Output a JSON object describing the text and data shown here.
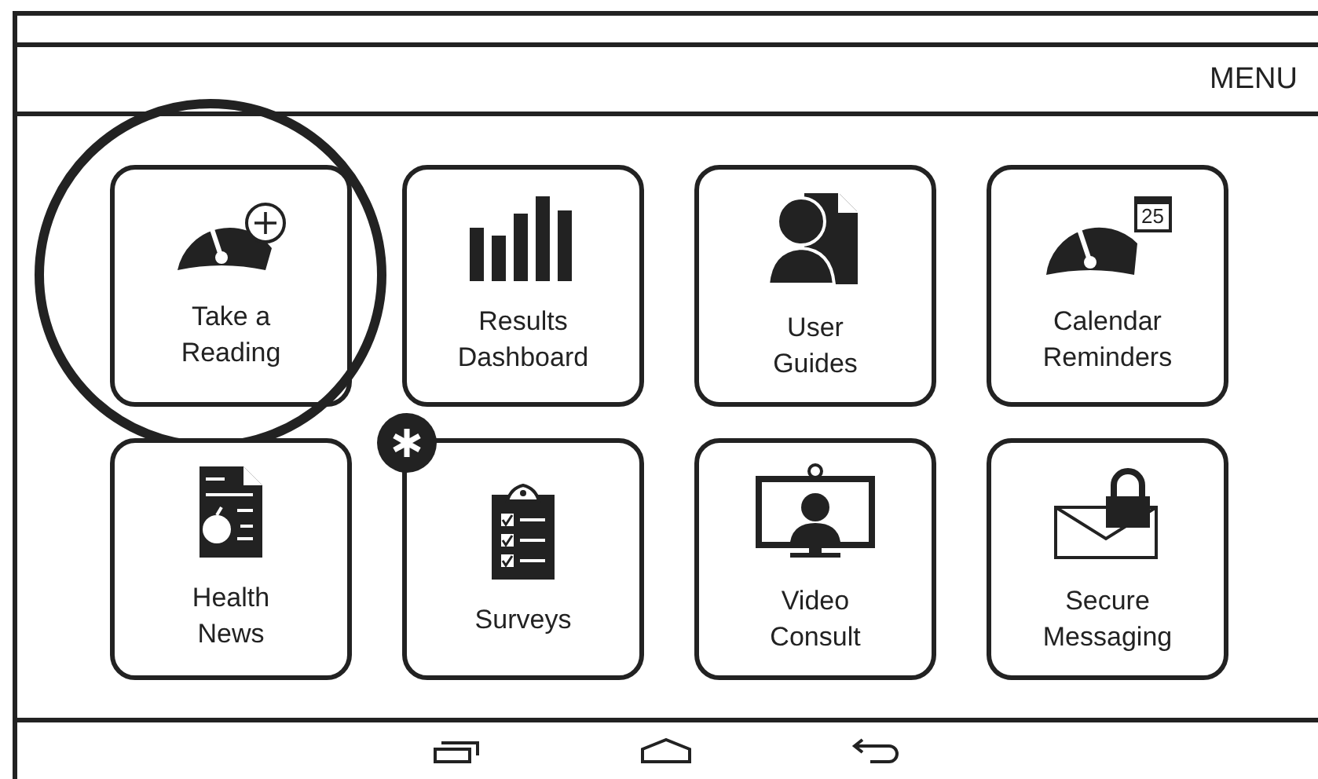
{
  "header": {
    "menu_label": "MENU"
  },
  "tiles": [
    {
      "kind": "reading",
      "label": [
        "Take a",
        "Reading"
      ],
      "highlighted": true,
      "badge": false
    },
    {
      "kind": "dashboard",
      "label": [
        "Results",
        "Dashboard"
      ],
      "highlighted": false,
      "badge": false
    },
    {
      "kind": "guides",
      "label": [
        "User",
        "Guides"
      ],
      "highlighted": false,
      "badge": false
    },
    {
      "kind": "calendar",
      "label": [
        "Calendar",
        "Reminders"
      ],
      "highlighted": false,
      "badge": false,
      "calendar_day": "25"
    },
    {
      "kind": "news",
      "label": [
        "Health",
        "News"
      ],
      "highlighted": false,
      "badge": false
    },
    {
      "kind": "surveys",
      "label": [
        "Surveys"
      ],
      "highlighted": false,
      "badge": true
    },
    {
      "kind": "video",
      "label": [
        "Video",
        "Consult"
      ],
      "highlighted": false,
      "badge": false
    },
    {
      "kind": "messaging",
      "label": [
        "Secure",
        "Messaging"
      ],
      "highlighted": false,
      "badge": false
    }
  ]
}
